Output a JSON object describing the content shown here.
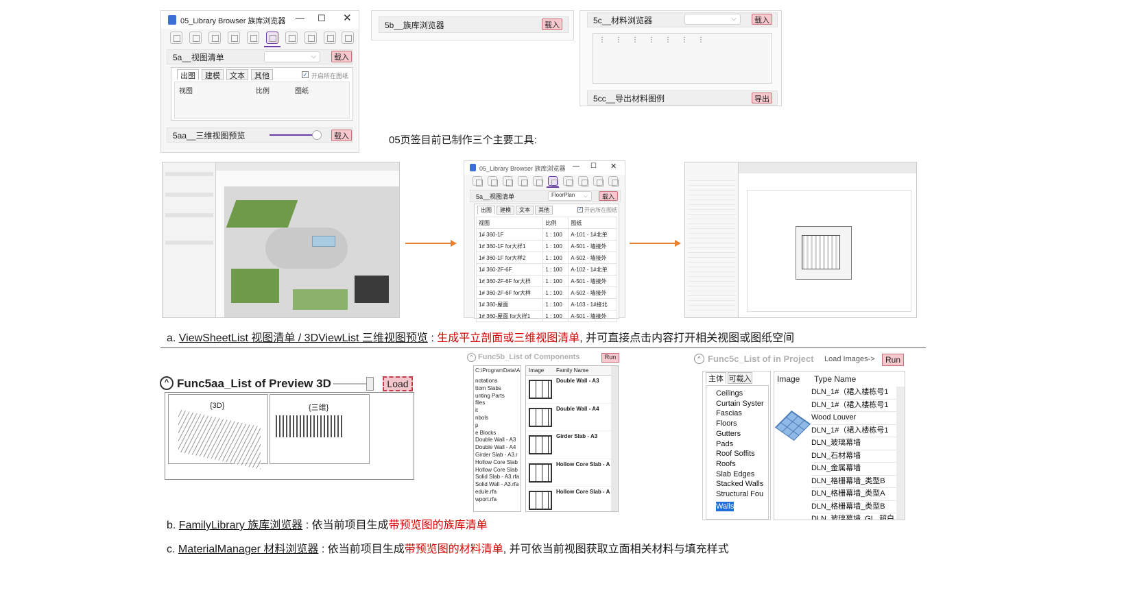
{
  "panel_5a": {
    "window_title": "05_Library Browser 族库浏览器",
    "section_title": "5a__视图清单",
    "load_label": "载入",
    "tabs": [
      "出图",
      "建模",
      "文本",
      "其他"
    ],
    "checkbox_label": "开启所在图纸",
    "columns": [
      "视图",
      "比例",
      "图纸"
    ],
    "preview_title": "5aa__三维视图预览",
    "preview_load_label": "载入"
  },
  "panel_5b": {
    "section_title": "5b__族库浏览器",
    "load_label": "载入"
  },
  "panel_5c": {
    "section_title": "5c__材料浏览器",
    "load_label": "载入",
    "export_title": "5cc__导出材料图例",
    "export_label": "导出"
  },
  "intro_text": "05页签目前已制作三个主要工具:",
  "mid_window": {
    "window_title": "05_Library Browser 族库浏览器",
    "section_title": "5a__视图清单",
    "combo_value": "FloorPlan",
    "load_label": "载入",
    "tabs": [
      "出图",
      "建模",
      "文本",
      "其他"
    ],
    "checkbox_label": "开启所在图纸",
    "columns": [
      "视图",
      "比例",
      "图纸"
    ],
    "rows": [
      [
        "1# 360-1F",
        "1 : 100",
        "A-101 - 1#北单"
      ],
      [
        "1# 360-1F for大样1",
        "1 : 100",
        "A-501 - 墙接外"
      ],
      [
        "1# 360-1F for大样2",
        "1 : 100",
        "A-502 - 墙接外"
      ],
      [
        "1# 360-2F-6F",
        "1 : 100",
        "A-102 - 1#北单"
      ],
      [
        "1# 360-2F-6F for大样",
        "1 : 100",
        "A-501 - 墙接外"
      ],
      [
        "1# 360-2F-6F for大样",
        "1 : 100",
        "A-502 - 墙接外"
      ],
      [
        "1# 360-屋面",
        "1 : 100",
        "A-103 - 1#接北"
      ],
      [
        "1# 360-屋面 for大样1",
        "1 : 100",
        "A-501 - 墙接外"
      ]
    ]
  },
  "caption_a": {
    "prefix": "a. ",
    "link": "ViewSheetList 视图清单 / 3DViewList 三维视图预览",
    "sep": " : ",
    "highlight": "生成平立剖面或三维视图清单",
    "rest": ", 并可直接点击内容打开相关视图或图纸空间"
  },
  "preview3d": {
    "title": "Func5aa_List of Preview 3D",
    "load_label": "Load",
    "thumbs": [
      "{3D}",
      "{三维}"
    ]
  },
  "func5b": {
    "title": "Func5b_List of Components",
    "run_label": "Run",
    "path": "C:\\ProgramData\\A",
    "files": [
      "notations",
      "ttom Slabs",
      "unting Parts",
      "files",
      "it",
      "nbols",
      "p",
      "e Blocks",
      "Double Wall - A3",
      "Double Wall - A4",
      "Girder Slab - A3.r",
      "Hollow Core Slab",
      "Hollow Core Slab",
      "Solid Slab - A3.rfa",
      "Solid Wall - A3.rfa",
      "edule.rfa",
      "wport.rfa"
    ],
    "columns": [
      "Image",
      "Family Name"
    ],
    "families": [
      "Double Wall - A3",
      "Double Wall - A4",
      "Girder Slab - A3",
      "Hollow Core Slab - A",
      "Hollow Core Slab - A"
    ]
  },
  "func5c": {
    "title": "Func5c_List of in Project",
    "load_images_label": "Load Images->",
    "run_label": "Run",
    "tabs": [
      "主体",
      "可载入"
    ],
    "categories": [
      "Ceilings",
      "Curtain Syster",
      "Fascias",
      "Floors",
      "Gutters",
      "Pads",
      "Roof Soffits",
      "Roofs",
      "Slab Edges",
      "Stacked Walls",
      "Structural Fou",
      "Walls"
    ],
    "columns": [
      "Image",
      "Type Name"
    ],
    "types": [
      "DLN_1#（裙入楼栋号1",
      "DLN_1#（裙入楼栋号1",
      "Wood Louver",
      "DLN_1#（裙入楼栋号1",
      "DLN_玻璃幕墙",
      "DLN_石材幕墙",
      "DLN_金属幕墙",
      "DLN_格栅幕墙_类型B",
      "DLN_格栅幕墙_类型A",
      "DLN_格栅幕墙_类型B",
      "DLN_玻璃幕墙_GL_超白"
    ]
  },
  "caption_b": {
    "prefix": "b. ",
    "link": "FamilyLibrary 族库浏览器",
    "sep": " : ",
    "plain": "依当前项目生成",
    "highlight": "带预览图的族库清单"
  },
  "caption_c": {
    "prefix": "c. ",
    "link": "MaterialManager 材料浏览器",
    "sep": " : ",
    "plain": "依当前项目生成",
    "highlight": "带预览图的材料清单",
    "rest": ", 并可依当前视图获取立面相关材料与填充样式"
  }
}
